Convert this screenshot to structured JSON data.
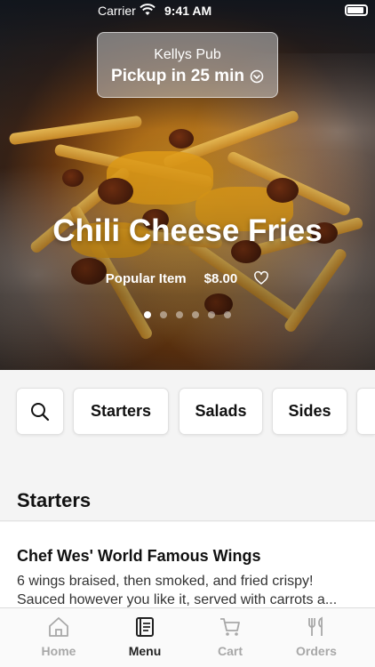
{
  "status_bar": {
    "carrier": "Carrier",
    "time": "9:41 AM"
  },
  "pickup": {
    "restaurant": "Kellys Pub",
    "eta": "Pickup in 25 min"
  },
  "hero": {
    "title": "Chili Cheese Fries",
    "tag": "Popular Item",
    "price": "$8.00",
    "carousel_count": 6,
    "carousel_active": 1
  },
  "categories": {
    "search_icon": "search-icon",
    "items": [
      "Starters",
      "Salads",
      "Sides"
    ]
  },
  "section": {
    "title": "Starters"
  },
  "menu_item": {
    "title": "Chef Wes' World Famous Wings",
    "description": "6 wings braised, then smoked, and fried crispy! Sauced however you like it, served with carrots a..."
  },
  "tab_bar": {
    "tabs": [
      {
        "label": "Home",
        "icon": "home-icon",
        "active": false
      },
      {
        "label": "Menu",
        "icon": "menu-book-icon",
        "active": true
      },
      {
        "label": "Cart",
        "icon": "cart-icon",
        "active": false
      },
      {
        "label": "Orders",
        "icon": "fork-knife-icon",
        "active": false
      }
    ]
  },
  "colors": {
    "active_tab": "#222222",
    "inactive_tab": "#a8a8a8",
    "background": "#f4f4f4"
  }
}
